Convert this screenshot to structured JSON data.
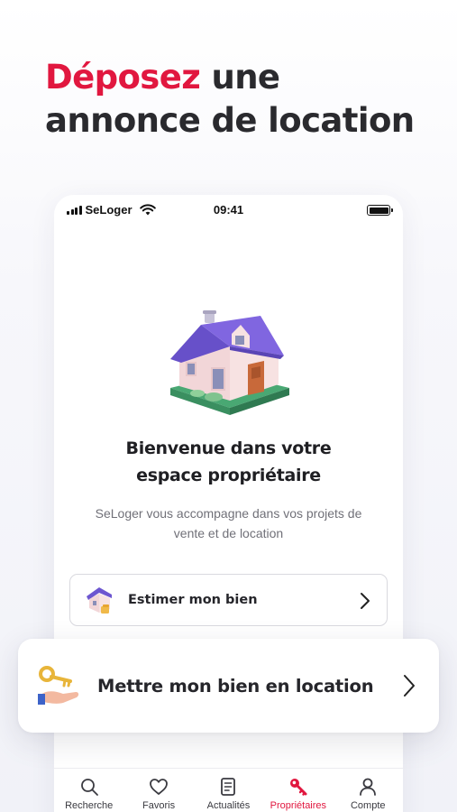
{
  "headline": {
    "accent": "Déposez",
    "rest": " une annonce de location"
  },
  "status_bar": {
    "carrier": "SeLoger",
    "time": "09:41"
  },
  "welcome": {
    "title": "Bienvenue dans votre\nespace propriétaire",
    "description": "SeLoger vous accompagne dans vos projets de vente et de location"
  },
  "actions": {
    "estimate_label": "Estimer mon bien",
    "rent_label": "Mettre mon bien en location"
  },
  "tab_bar": {
    "items": [
      {
        "label": "Recherche",
        "icon": "search-icon"
      },
      {
        "label": "Favoris",
        "icon": "heart-icon"
      },
      {
        "label": "Actualités",
        "icon": "news-icon"
      },
      {
        "label": "Propriétaires",
        "icon": "key-icon",
        "active": true
      },
      {
        "label": "Compte",
        "icon": "user-icon"
      }
    ]
  },
  "colors": {
    "accent": "#e1173f",
    "text": "#26262b",
    "muted": "#707078"
  }
}
